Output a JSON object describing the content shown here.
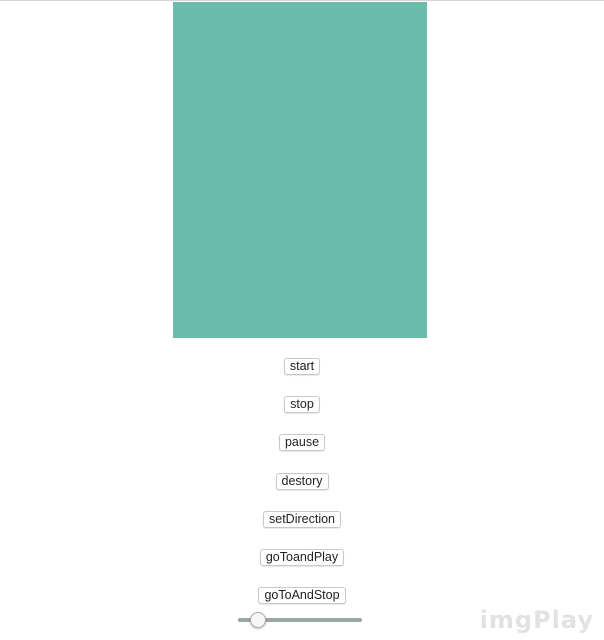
{
  "animation": {
    "color": "#6cbcac"
  },
  "controls": {
    "start_label": "start",
    "stop_label": "stop",
    "pause_label": "pause",
    "destroy_label": "destory",
    "set_direction_label": "setDirection",
    "go_to_and_play_label": "goToandPlay",
    "go_to_and_stop_label": "goToAndStop"
  },
  "slider": {
    "value_fraction": 0.15,
    "track_color": "#9aa7a3"
  },
  "watermark": {
    "text": "imgPlay"
  }
}
